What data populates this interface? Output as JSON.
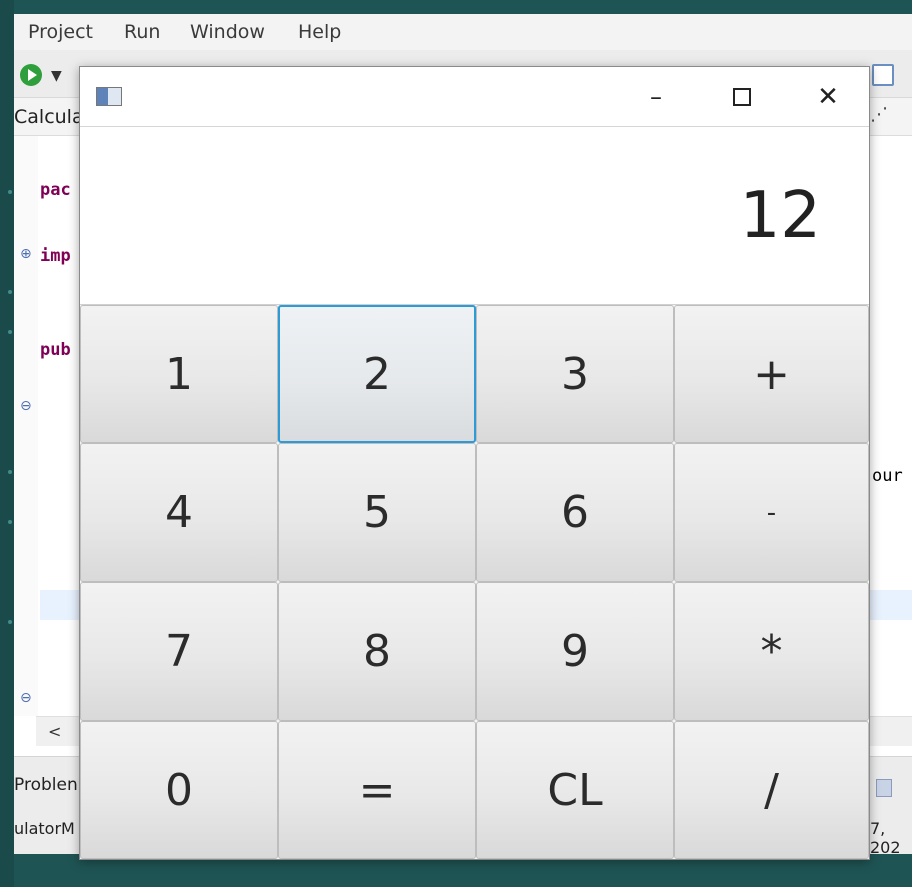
{
  "ide": {
    "menu": [
      "Project",
      "Run",
      "Window",
      "Help"
    ],
    "tab_label": "Calcula",
    "code_lines": [
      "pac",
      "imp",
      "pub"
    ],
    "code_right": "our",
    "problems_label": "Problen",
    "status_left": "ulatorM",
    "status_right": "7, 202"
  },
  "calculator": {
    "display": "12",
    "buttons": [
      {
        "label": "1"
      },
      {
        "label": "2",
        "focused": true
      },
      {
        "label": "3"
      },
      {
        "label": "+"
      },
      {
        "label": "4"
      },
      {
        "label": "5"
      },
      {
        "label": "6"
      },
      {
        "label": "-"
      },
      {
        "label": "7"
      },
      {
        "label": "8"
      },
      {
        "label": "9"
      },
      {
        "label": "*"
      },
      {
        "label": "0"
      },
      {
        "label": "="
      },
      {
        "label": "CL"
      },
      {
        "label": "/"
      }
    ],
    "window_controls": {
      "minimize": "–",
      "close": "✕"
    }
  }
}
